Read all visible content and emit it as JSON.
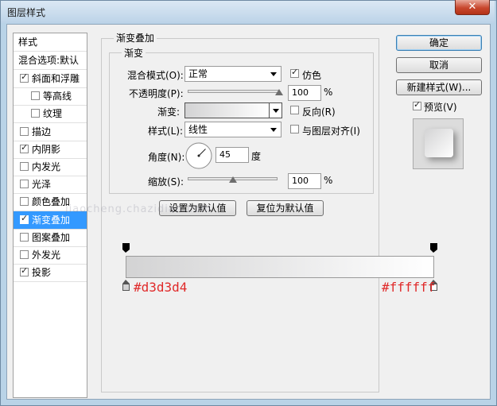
{
  "window": {
    "title": "图层样式",
    "close_glyph": "✕"
  },
  "left_panel": {
    "header": "样式",
    "blend_options": "混合选项:默认",
    "items": [
      {
        "label": "斜面和浮雕",
        "checked": true,
        "indent": false
      },
      {
        "label": "等高线",
        "checked": false,
        "indent": true
      },
      {
        "label": "纹理",
        "checked": false,
        "indent": true
      },
      {
        "label": "描边",
        "checked": false,
        "indent": false
      },
      {
        "label": "内阴影",
        "checked": true,
        "indent": false
      },
      {
        "label": "内发光",
        "checked": false,
        "indent": false
      },
      {
        "label": "光泽",
        "checked": false,
        "indent": false
      },
      {
        "label": "颜色叠加",
        "checked": false,
        "indent": false
      },
      {
        "label": "渐变叠加",
        "checked": true,
        "indent": false,
        "selected": true
      },
      {
        "label": "图案叠加",
        "checked": false,
        "indent": false
      },
      {
        "label": "外发光",
        "checked": false,
        "indent": false
      },
      {
        "label": "投影",
        "checked": true,
        "indent": false
      }
    ]
  },
  "gradient_overlay": {
    "group_title": "渐变叠加",
    "subgroup_title": "渐变",
    "blend_mode_label": "混合模式(O):",
    "blend_mode_value": "正常",
    "dither_label": "仿色",
    "dither_checked": true,
    "opacity_label": "不透明度(P):",
    "opacity_value": "100",
    "opacity_fraction": 1.0,
    "percent": "%",
    "gradient_label": "渐变:",
    "reverse_label": "反向(R)",
    "reverse_checked": false,
    "style_label": "样式(L):",
    "style_value": "线性",
    "align_label": "与图层对齐(I)",
    "align_checked": false,
    "angle_label": "角度(N):",
    "angle_value": "45",
    "angle_deg": 45,
    "degree_unit": "度",
    "scale_label": "缩放(S):",
    "scale_value": "100",
    "scale_fraction": 0.5,
    "reset_default_btn": "设置为默认值",
    "restore_default_btn": "复位为默认值"
  },
  "right_panel": {
    "ok": "确定",
    "cancel": "取消",
    "new_style": "新建样式(W)...",
    "preview_label": "预览(V)",
    "preview_checked": true
  },
  "gradient_editor": {
    "start_color": "#d3d3d4",
    "end_color": "#ffffff",
    "start_label": "#d3d3d4",
    "end_label": "#ffffff"
  },
  "watermark": "jiaocheng.chazidian.com"
}
